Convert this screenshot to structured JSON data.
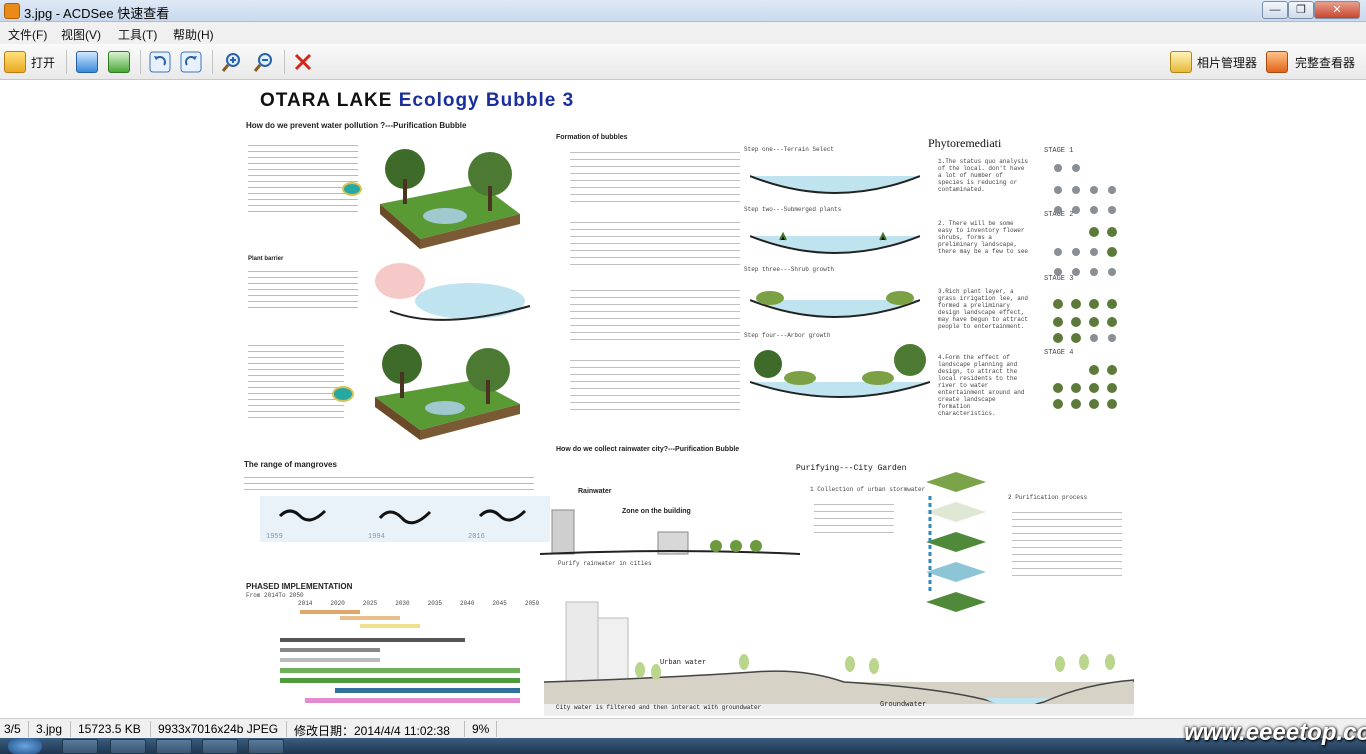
{
  "window": {
    "title": "3.jpg - ACDSee 快速查看",
    "min_label": "—",
    "max_label": "❐",
    "close_label": "✕"
  },
  "menu": {
    "file": "文件(F)",
    "view": "视图(V)",
    "tools": "工具(T)",
    "help": "帮助(H)"
  },
  "toolbar": {
    "open_label": "打开",
    "photo_manager_label": "相片管理器",
    "full_viewer_label": "完整查看器"
  },
  "poster": {
    "title_prefix": "OTARA LAKE ",
    "title_highlight": "Ecology Bubble 3",
    "q1": "How do we prevent water pollution ?---Purification Bubble",
    "formation": "Formation of bubbles",
    "phyto": "Phytoremediati",
    "stage1": "STAGE 1",
    "stage2": "STAGE 2",
    "stage3": "STAGE 3",
    "stage4": "STAGE 4",
    "step1": "Step one---Terrain Select",
    "step2": "Step two---Submerged plants",
    "step3": "Step three---Shrub growth",
    "step4": "Step four---Arbor growth",
    "plant_barrier": "Plant barrier",
    "mangroves": "The range of mangroves",
    "q2": "How do we collect rainwater city?---Purification Bubble",
    "rainwater": "Rainwater",
    "zone": "Zone on the building",
    "purify_city": "Purify rainwater in cities",
    "city_garden": "Purifying---City Garden",
    "collection": "1 Collection of urban stormwater",
    "purification": "2 Purification process",
    "phased": "PHASED IMPLEMENTATION",
    "phased_sub": "From 2014To 2050",
    "years": "2014     2020     2025     2030     2035     2040     2045     2050",
    "urban_water": "Urban water",
    "groundwater": "Groundwater",
    "city_water": "City water is filtered and then interact with groundwater",
    "year1959": "1959",
    "year1994": "1994",
    "year2016": "2016",
    "phyto_p1": "1.The status quo analysis of the local. don't have a lot of number of species is reducing or contaminated.",
    "phyto_p2": "2. There will be some easy to inventory flower shrubs, forms a preliminary landscape, there may be a few to see",
    "phyto_p3": "3.Rich plant layer, a grass irrigation lee, and formed a preliminary design landscape effect, may have begun to attract people to entertainment.",
    "phyto_p4": "4.Form the effect of landscape planning and design, to attract the local residents to the river to water entertainment around and create landscape formation characteristics."
  },
  "status": {
    "index": "3/5",
    "file": "3.jpg",
    "size": "15723.5 KB",
    "dims": "9933x7016x24b JPEG",
    "modified": "修改日期：2014/4/4 11:02:38",
    "zoom": "9%"
  },
  "watermark": "www.eeeetop.com",
  "colors": {
    "accent_title": "#1b2f9c",
    "close_red": "#c8452c"
  }
}
